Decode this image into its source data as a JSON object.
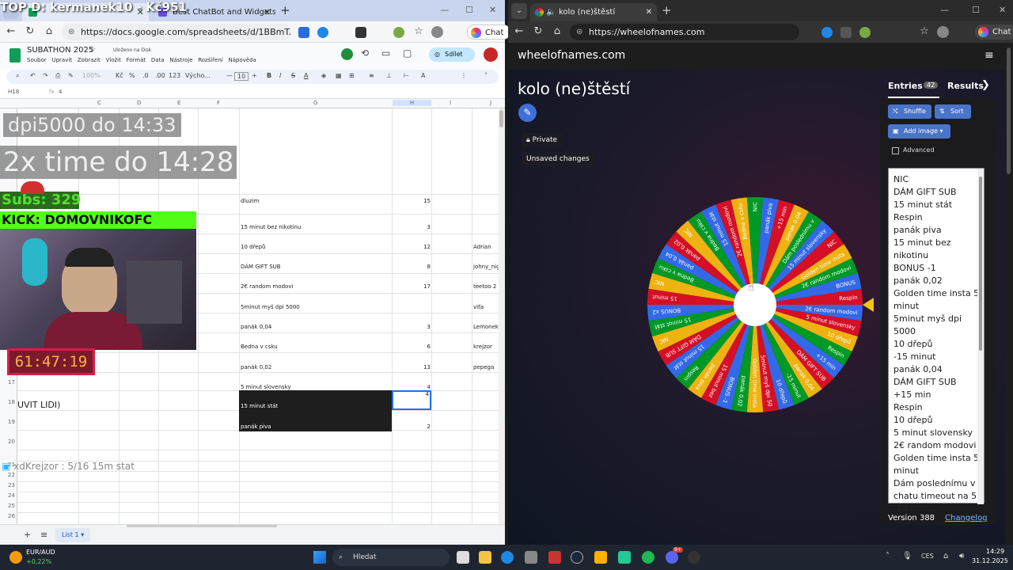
{
  "overlay": {
    "top_text": "TOP D: kermanek10 - Kč951",
    "line1": "dpi5000 do 14:33",
    "line2": "2x time do 14:28",
    "subs": "Subs: 329",
    "kick": "KICK: DOMOVNIKOFC",
    "timer": "61:47:19",
    "uvit": "UVIT LIDI)",
    "chat": "xdKrejzor : 5/16 15m stat"
  },
  "left_browser": {
    "tab2_label": "Best ChatBot and Widgets for",
    "url": "https://docs.google.com/spreadsheets/d/1BBmT...",
    "chat_label": "Chat"
  },
  "sheets": {
    "title": "SUBATHON 2025",
    "saved": "Uloženo na Disk",
    "menus": [
      "Soubor",
      "Upravit",
      "Zobrazit",
      "Vložit",
      "Formát",
      "Data",
      "Nástroje",
      "Rozšíření",
      "Nápověda"
    ],
    "share_label": "Sdílet",
    "zoom": "100%",
    "currency": "Kč",
    "percent": "%",
    "font": "Výcho...",
    "font_size": "10",
    "cell_ref": "H18",
    "formula": "4",
    "columns": [
      "C",
      "D",
      "E",
      "F",
      "G",
      "H",
      "I",
      "J"
    ],
    "rows": [
      {
        "g": "dluzim",
        "h": "15",
        "j": ""
      },
      {
        "g": "15 minut bez nikotinu",
        "h": "3",
        "j": ""
      },
      {
        "g": "10 dřepů",
        "h": "12",
        "j": "Adrian"
      },
      {
        "g": "DÁM GIFT SUB",
        "h": "8",
        "j": "johny_nig"
      },
      {
        "g": "2€ random modovi",
        "h": "17",
        "j": "teetoo 2"
      },
      {
        "g": "5minut myš dpi 5000",
        "h": "",
        "j": "viťa"
      },
      {
        "g": "panák 0,04",
        "h": "3",
        "j": "Lemonek 1"
      },
      {
        "g": "Bedna v csku",
        "h": "6",
        "j": "krejzor"
      },
      {
        "g": "panák 0,02",
        "h": "13",
        "j": "pepega"
      },
      {
        "g": "5 minut slovensky",
        "h": "4",
        "j": ""
      },
      {
        "g": "15 minut stát",
        "h": "4",
        "j": ""
      },
      {
        "g": "panák piva",
        "h": "2",
        "j": ""
      }
    ],
    "row_numbers": [
      "17",
      "18",
      "19",
      "20",
      "21",
      "22",
      "23",
      "24",
      "25",
      "26",
      "27",
      "28"
    ],
    "sheet_tab": "List 1"
  },
  "right_browser": {
    "tab_label": "kolo (ne)štěstí",
    "url": "https://wheelofnames.com",
    "chat_label": "Chat"
  },
  "wheel": {
    "site": "wheelofnames.com",
    "title": "kolo (ne)štěstí",
    "private": "Private",
    "unsaved": "Unsaved changes",
    "tab_entries": "Entries",
    "entries_count": "42",
    "tab_results": "Results",
    "shuffle": "Shuffle",
    "sort": "Sort",
    "add_image": "Add image",
    "advanced": "Advanced",
    "entries": [
      "NIC",
      "DÁM GIFT SUB",
      "15 minut stát",
      "Respin",
      "panák piva",
      "15 minut bez",
      "nikotinu",
      "BONUS -1",
      "panák 0,02",
      "Golden time insta 5",
      "minut",
      "5minut myš dpi 5000",
      "10 dřepů",
      "-15 minut",
      "panák 0,04",
      "DÁM GIFT SUB",
      "+15 min",
      "Respin",
      "10 dřepů",
      "5 minut slovensky",
      "2€ random modovi",
      "Golden time insta 5",
      "minut",
      "Dám poslednímu v",
      "chatu timeout na 5",
      "-15 minut"
    ],
    "version": "Version 388",
    "changelog": "Changelog",
    "segment_colors": [
      "#3369e8",
      "#d50f25",
      "#eeb211",
      "#009925"
    ],
    "segment_labels": [
      "2€ random modovi",
      "5 minut slovensky",
      "10 dřepů",
      "Respin",
      "+15 min",
      "DÁM GIFT SUB",
      "panák 0,04",
      "-15 minut",
      "10 dřepů",
      "5minut myš dpi 50",
      "Golden time insta",
      "panák 0,02",
      "BONUS -1",
      "15 minut bez",
      "panák piva",
      "Respin",
      "15 minut stát",
      "DÁM GIFT SUB",
      "NIC",
      "15 minut stát",
      "BONUS x2",
      "15 minut",
      "NIC",
      "Bedna v csku",
      "panák 0,04",
      "panák 0,02",
      "NIC",
      "Bedna v csku",
      "15 minut stát",
      "2€ random modovi",
      "Bedna v csku",
      "NIC",
      "panák piva",
      "+15 min",
      "panák 0,04",
      "Dám poslednímu v",
      "15 minut slovensky",
      "NIC",
      "Golden time insta",
      "2€ random modovi",
      "BONUS",
      "Respin"
    ]
  },
  "taskbar": {
    "stock_name": "EUR/AUD",
    "stock_change": "+0,22%",
    "search": "Hledat",
    "lang": "CES",
    "time": "14:29",
    "date": "31.12.2025",
    "badge": "9+"
  }
}
